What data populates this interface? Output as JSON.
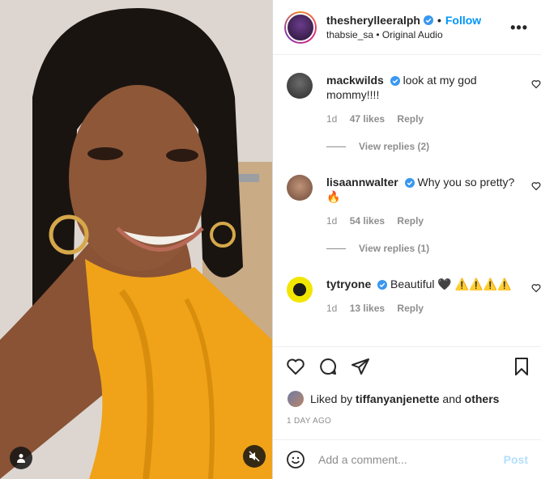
{
  "header": {
    "username": "thesherylleeralph",
    "follow_label": "Follow",
    "separator": "•",
    "subline": "thabsie_sa • Original Audio",
    "more_label": "•••"
  },
  "comments": [
    {
      "username": "mackwilds",
      "text": "look at my god mommy!!!!",
      "time": "1d",
      "likes": "47 likes",
      "reply_label": "Reply",
      "view_replies": "View replies (2)"
    },
    {
      "username": "lisaannwalter",
      "text": "Why you so pretty? 🔥",
      "time": "1d",
      "likes": "54 likes",
      "reply_label": "Reply",
      "view_replies": "View replies (1)"
    },
    {
      "username": "tytryone",
      "text": "Beautiful 🖤 ⚠️⚠️⚠️⚠️",
      "time": "1d",
      "likes": "13 likes",
      "reply_label": "Reply"
    }
  ],
  "liked_by": {
    "prefix": "Liked by",
    "user": "tiffanyanjenette",
    "conjunction": "and",
    "others": "others"
  },
  "date": "1 DAY AGO",
  "add_comment": {
    "placeholder": "Add a comment...",
    "post_label": "Post"
  },
  "colors": {
    "accent": "#0095f6",
    "verified": "#3897f0",
    "dress": "#f0a318",
    "muted_text": "#8e8e8e"
  }
}
